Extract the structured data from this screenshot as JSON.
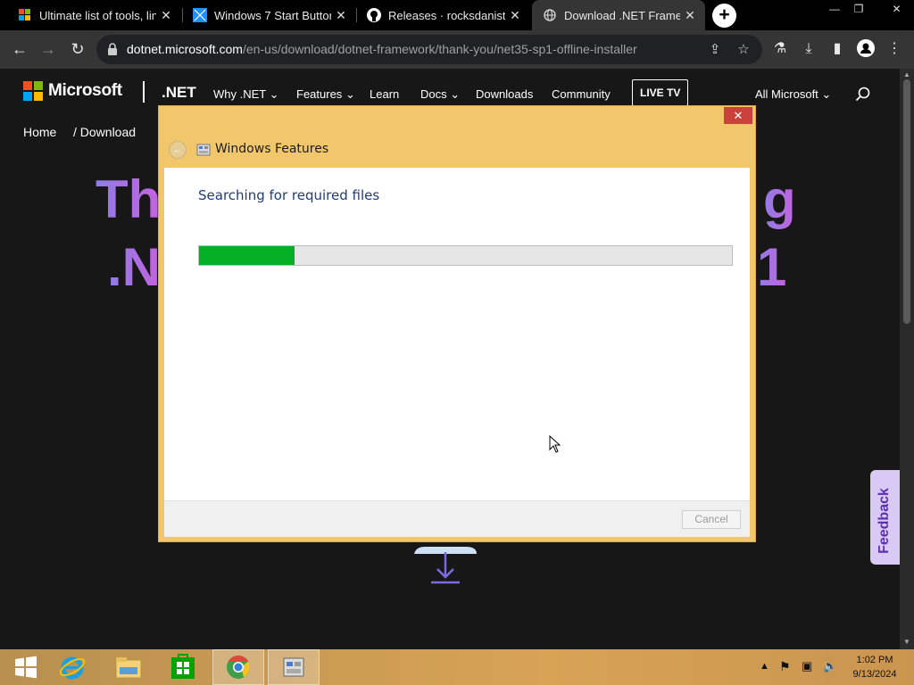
{
  "browser": {
    "tabs": [
      {
        "title": "Ultimate list of tools, lin",
        "icon": "windows-flag-icon"
      },
      {
        "title": "Windows 7 Start Button",
        "icon": "windows-tile-icon"
      },
      {
        "title": "Releases · rocksdanister",
        "icon": "github-icon"
      },
      {
        "title": "Download .NET Framew",
        "icon": "globe-icon",
        "active": true
      }
    ],
    "url_domain": "dotnet.microsoft.com",
    "url_path": "/en-us/download/dotnet-framework/thank-you/net35-sp1-offline-installer"
  },
  "site": {
    "brand": "Microsoft",
    "product": ".NET",
    "nav": [
      "Why .NET",
      "Features",
      "Learn",
      "Docs",
      "Downloads",
      "Community"
    ],
    "live_tv": "LIVE TV",
    "all_microsoft": "All Microsoft",
    "breadcrumb": [
      "Home",
      "/  Download"
    ],
    "hero_line1_left": "Th",
    "hero_line1_right": "g",
    "hero_line2_left": ".N",
    "hero_line2_right": "1",
    "feedback": "Feedback"
  },
  "dialog": {
    "title": "Windows Features",
    "status": "Searching for required files",
    "progress_percent": 18,
    "cancel": "Cancel",
    "close": "✕"
  },
  "taskbar": {
    "time": "1:02 PM",
    "date": "9/13/2024",
    "apps": [
      "start-icon",
      "internet-explorer-icon",
      "file-explorer-icon",
      "store-icon",
      "chrome-icon",
      "windows-features-icon"
    ]
  },
  "colors": {
    "dialog_frame": "#f2c76b",
    "progress_fill": "#06b025",
    "hero_gradient_start": "#8f7ce4",
    "hero_gradient_end": "#c463e0"
  }
}
